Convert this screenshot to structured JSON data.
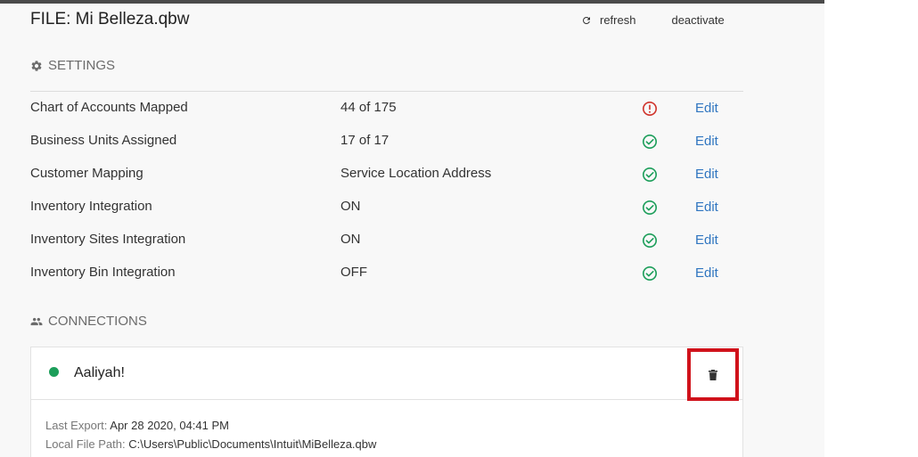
{
  "file": {
    "title": "FILE: Mi Belleza.qbw"
  },
  "header": {
    "refresh_label": "refresh",
    "deactivate_label": "deactivate"
  },
  "settings": {
    "heading": "SETTINGS",
    "rows": [
      {
        "label": "Chart of Accounts Mapped",
        "value": "44 of 175",
        "status": "warning",
        "edit_label": "Edit"
      },
      {
        "label": "Business Units Assigned",
        "value": "17 of 17",
        "status": "ok",
        "edit_label": "Edit"
      },
      {
        "label": "Customer Mapping",
        "value": "Service Location Address",
        "status": "ok",
        "edit_label": "Edit"
      },
      {
        "label": "Inventory Integration",
        "value": "ON",
        "status": "ok",
        "edit_label": "Edit"
      },
      {
        "label": "Inventory Sites Integration",
        "value": "ON",
        "status": "ok",
        "edit_label": "Edit"
      },
      {
        "label": "Inventory Bin Integration",
        "value": "OFF",
        "status": "ok",
        "edit_label": "Edit"
      }
    ]
  },
  "connections": {
    "heading": "CONNECTIONS",
    "items": [
      {
        "name": "Aaliyah!",
        "status": "connected",
        "last_export_label": "Last Export:",
        "last_export_value": "Apr 28 2020, 04:41 PM",
        "file_path_label": "Local File Path:",
        "file_path_value": "C:\\Users\\Public\\Documents\\Intuit\\MiBelleza.qbw"
      }
    ]
  },
  "colors": {
    "ok": "#1c9e5a",
    "warning": "#d0342c",
    "link": "#2f75c0",
    "highlight_box": "#d0121b"
  },
  "icons": {
    "refresh": "refresh-icon",
    "settings": "gear-icon",
    "connections": "people-icon",
    "delete": "trash-icon",
    "ok": "check-circle-icon",
    "warning": "alert-circle-icon"
  }
}
